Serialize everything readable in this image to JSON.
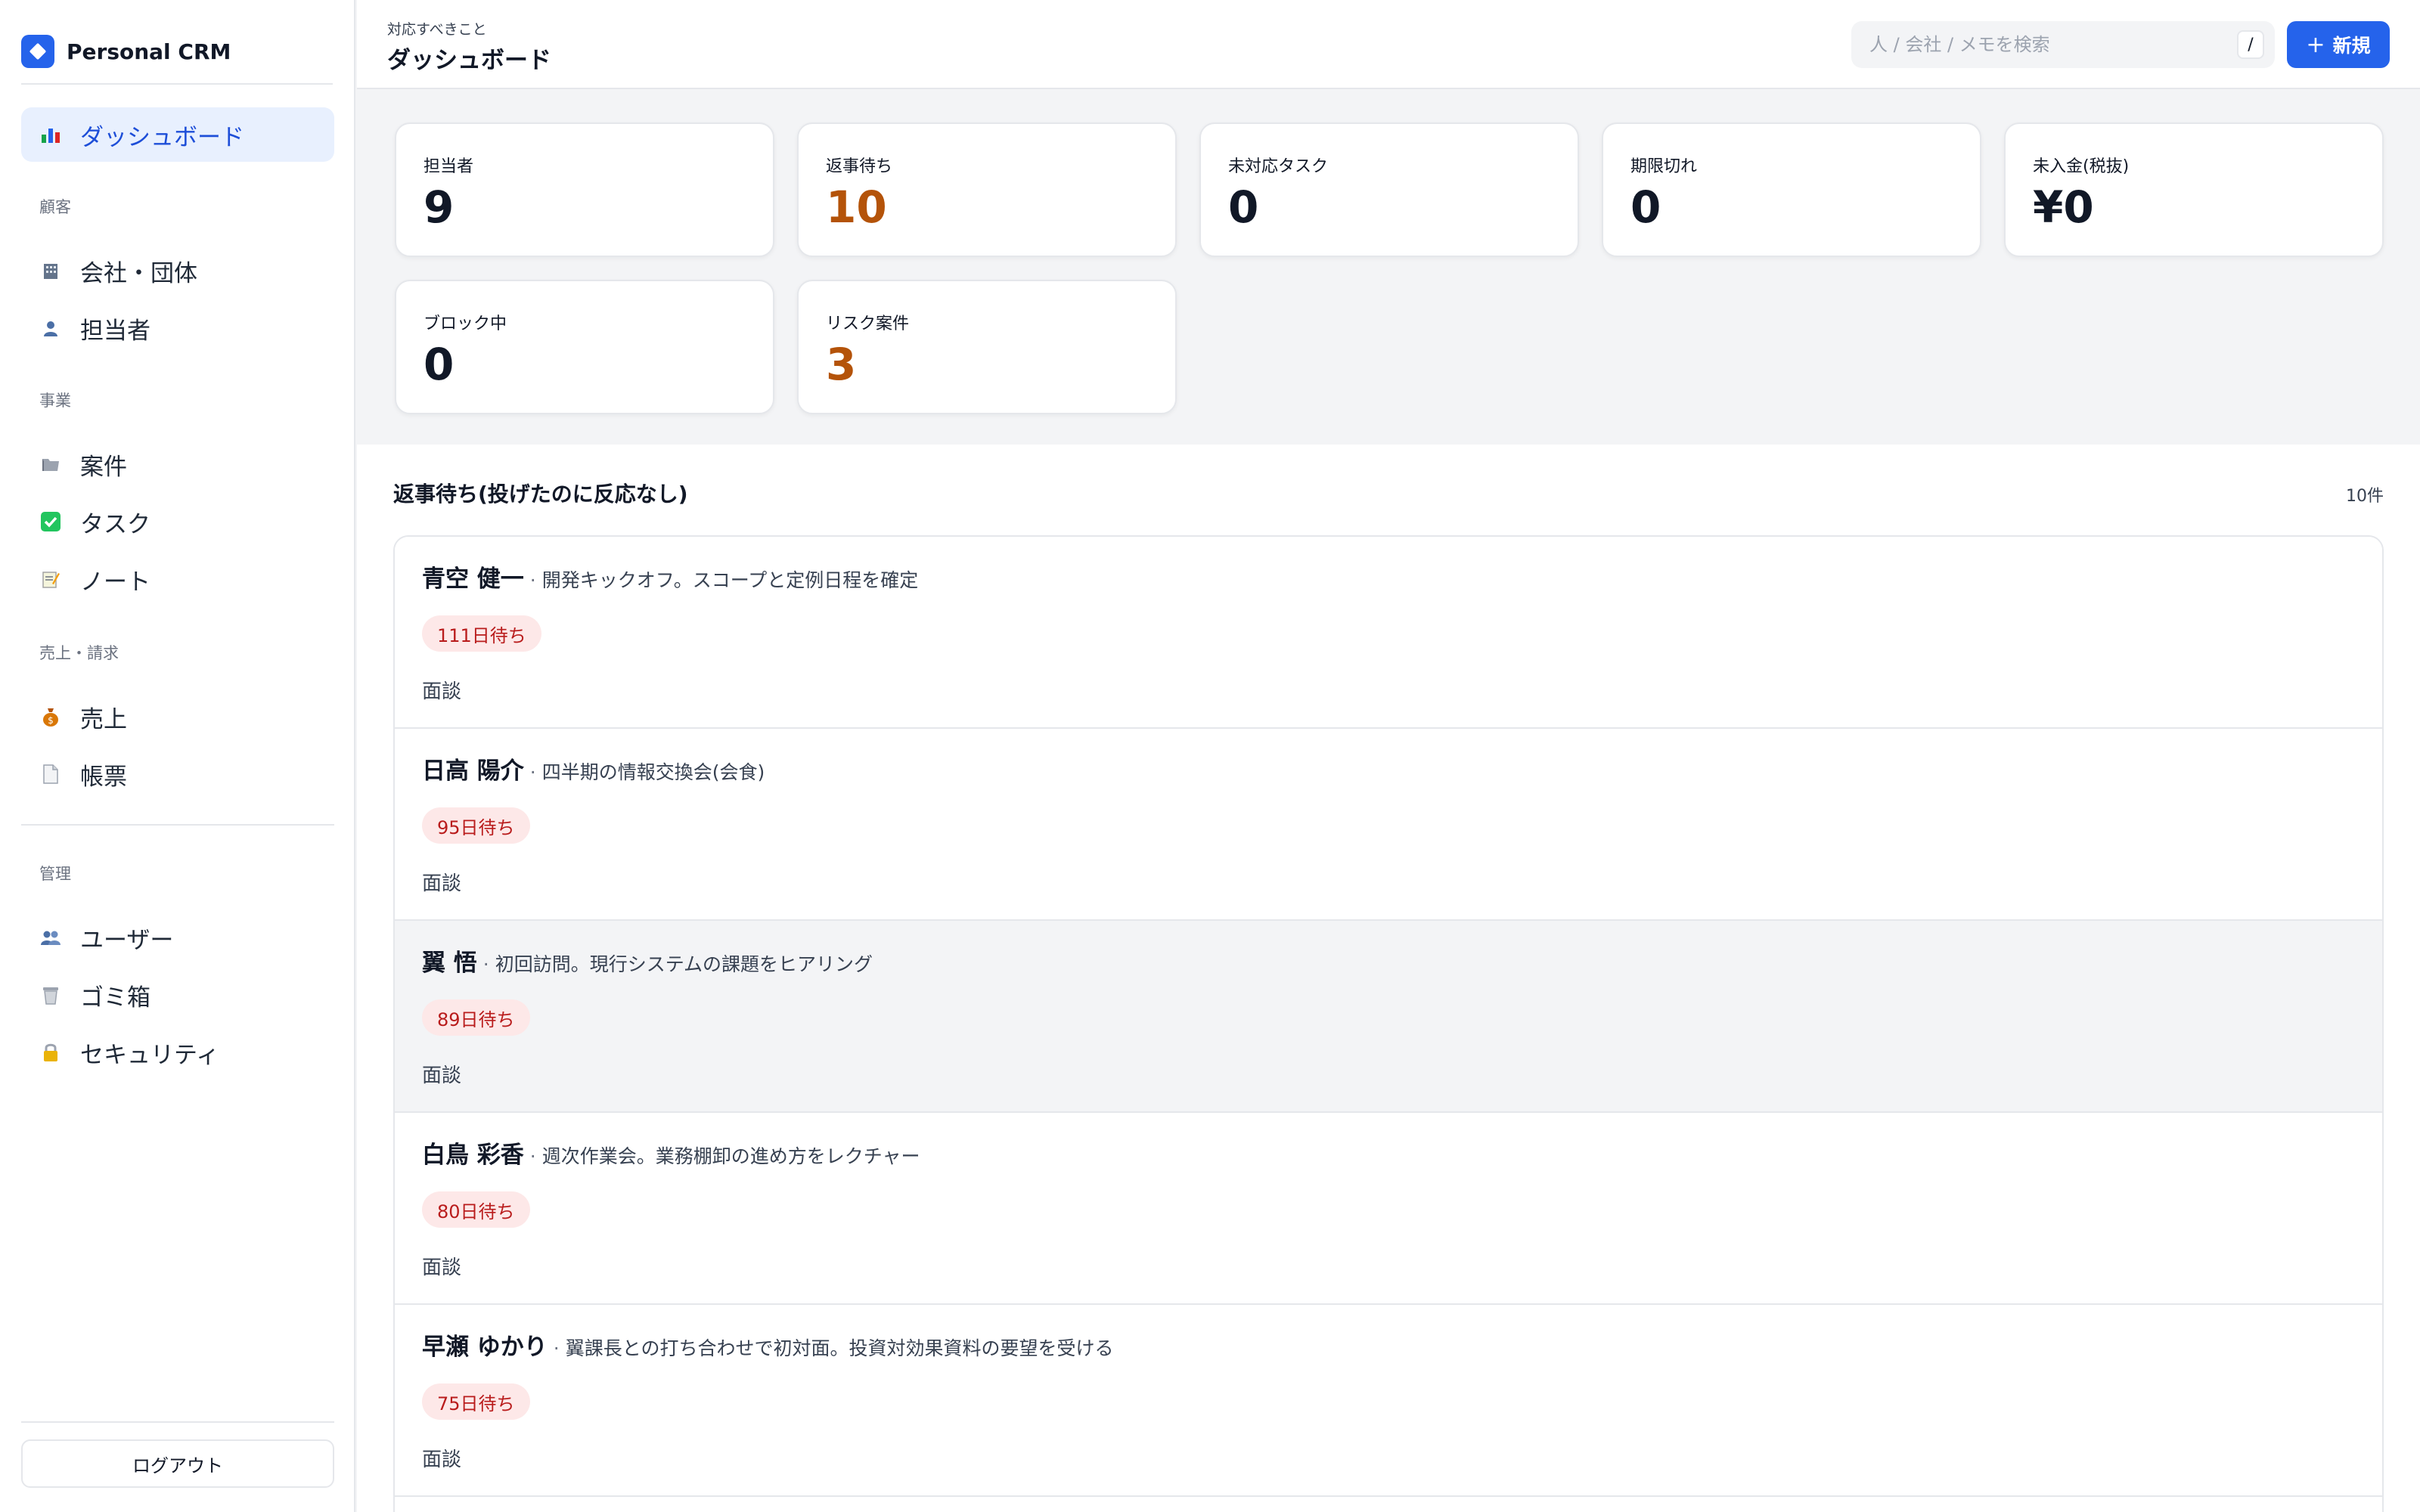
{
  "app": {
    "name": "Personal CRM"
  },
  "sidebar": {
    "active": {
      "label": "ダッシュボード",
      "icon": "bar-chart-icon"
    },
    "sections": {
      "customers": "顧客",
      "business": "事業",
      "sales": "売上・請求",
      "admin": "管理"
    },
    "items": [
      {
        "label": "会社・団体",
        "icon": "office-building-icon"
      },
      {
        "label": "担当者",
        "icon": "person-icon"
      },
      {
        "label": "案件",
        "icon": "folder-icon"
      },
      {
        "label": "タスク",
        "icon": "check-box-icon"
      },
      {
        "label": "ノート",
        "icon": "memo-icon"
      },
      {
        "label": "売上",
        "icon": "money-bag-icon"
      },
      {
        "label": "帳票",
        "icon": "document-icon"
      },
      {
        "label": "ユーザー",
        "icon": "users-icon"
      },
      {
        "label": "ゴミ箱",
        "icon": "trash-icon"
      },
      {
        "label": "セキュリティ",
        "icon": "lock-icon"
      }
    ],
    "logout_label": "ログアウト"
  },
  "header": {
    "subtitle": "対応すべきこと",
    "title": "ダッシュボード",
    "search_placeholder": "人 / 会社 / メモを検索",
    "search_shortcut": "/",
    "new_button": "新規",
    "new_button_icon": "plus-icon"
  },
  "stats": [
    {
      "label": "担当者",
      "value": "9"
    },
    {
      "label": "返事待ち",
      "value": "10",
      "highlight": true
    },
    {
      "label": "未対応タスク",
      "value": "0"
    },
    {
      "label": "期限切れ",
      "value": "0"
    },
    {
      "label": "未入金(税抜)",
      "value": "¥0"
    },
    {
      "label": "ブロック中",
      "value": "0"
    },
    {
      "label": "リスク案件",
      "value": "3",
      "highlight": true
    }
  ],
  "awaiting": {
    "title": "返事待ち(投げたのに反応なし)",
    "count": "10件",
    "separator": "·",
    "rows": [
      {
        "name": "青空 健一",
        "desc": "開発キックオフ。スコープと定例日程を確定",
        "badge": "111日待ち",
        "type": "面談"
      },
      {
        "name": "日高 陽介",
        "desc": "四半期の情報交換会(会食)",
        "badge": "95日待ち",
        "type": "面談"
      },
      {
        "name": "翼 悟",
        "desc": "初回訪問。現行システムの課題をヒアリング",
        "badge": "89日待ち",
        "type": "面談"
      },
      {
        "name": "白鳥 彩香",
        "desc": "週次作業会。業務棚卸の進め方をレクチャー",
        "badge": "80日待ち",
        "type": "面談"
      },
      {
        "name": "早瀬 ゆかり",
        "desc": "翼課長との打ち合わせで初対面。投資対効果資料の要望を受ける",
        "badge": "75日待ち",
        "type": "面談"
      }
    ]
  },
  "colors": {
    "accent": "#2563eb",
    "active_bg": "#e8f0fe",
    "warn": "#b45309",
    "badge_bg": "#fde8e8",
    "badge_text": "#b91c1c"
  }
}
